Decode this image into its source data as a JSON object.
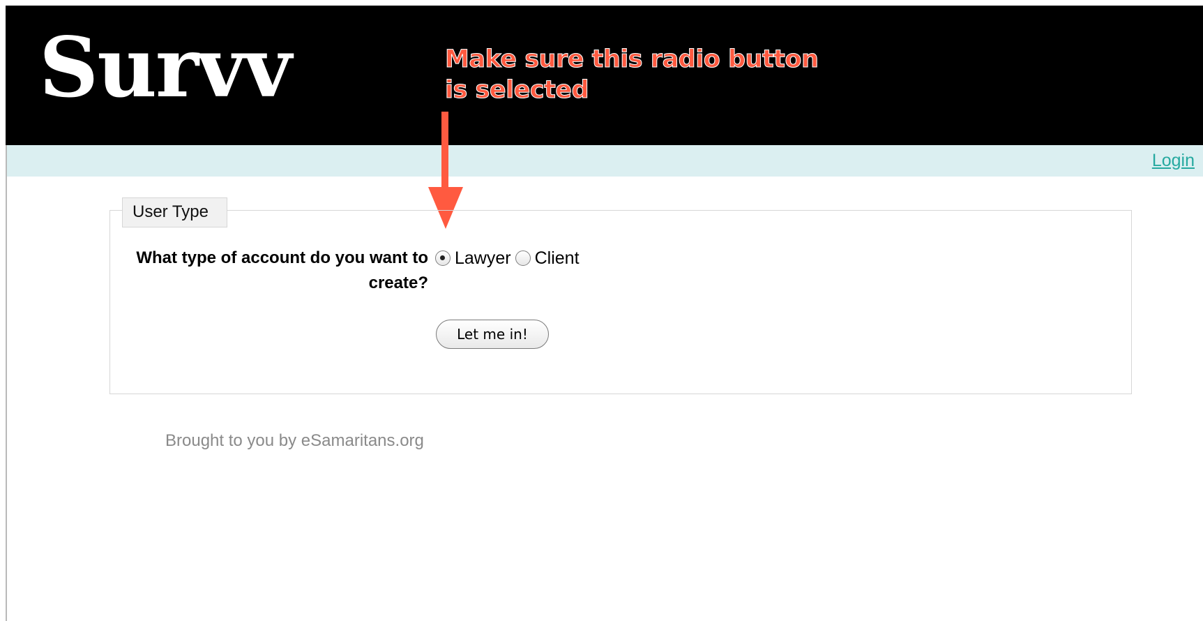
{
  "header": {
    "logo_text": "Survv",
    "annotation_lines": [
      "Make sure this radio button",
      "is selected"
    ]
  },
  "nav": {
    "login_label": "Login"
  },
  "form": {
    "legend": "User Type",
    "question": "What type of account do you want to create?",
    "options": [
      {
        "label": "Lawyer",
        "selected": true
      },
      {
        "label": "Client",
        "selected": false
      }
    ],
    "submit_label": "Let me in!"
  },
  "footer": {
    "text": "Brought to you by eSamaritans.org"
  },
  "colors": {
    "header_background": "#000000",
    "nav_strip": "#dbeff1",
    "link": "#26a9a0",
    "annotation": "#ff5a40"
  },
  "icons": {
    "annotation_arrow": "arrow-down-icon"
  }
}
